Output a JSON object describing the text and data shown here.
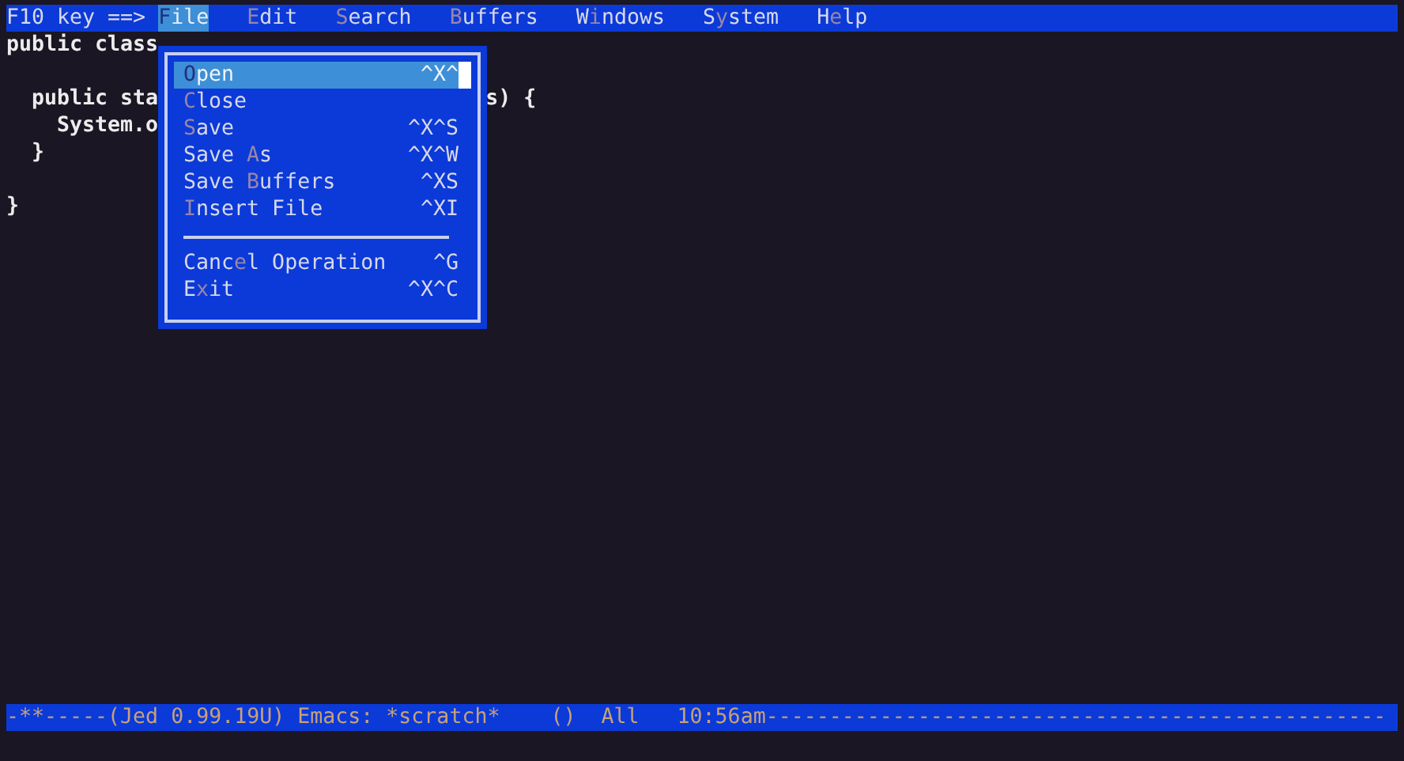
{
  "menubar": {
    "prompt": "F10 key ==>",
    "items": [
      {
        "key": "F",
        "after": "ile",
        "selected": true
      },
      {
        "key": "E",
        "after": "dit",
        "selected": false
      },
      {
        "key": "S",
        "after": "earch",
        "selected": false
      },
      {
        "key": "B",
        "after": "uffers",
        "selected": false
      },
      {
        "before": "W",
        "key": "i",
        "after": "ndows",
        "selected": false
      },
      {
        "before": "S",
        "key": "y",
        "after": "stem",
        "selected": false
      },
      {
        "before": "H",
        "key": "e",
        "after": "lp",
        "selected": false
      }
    ]
  },
  "code_lines": [
    {
      "kind": "text",
      "left": "public class"
    },
    {
      "kind": "blank"
    },
    {
      "kind": "text",
      "left": "  public sta",
      "right": "s) {"
    },
    {
      "kind": "text",
      "left": "    System.o"
    },
    {
      "kind": "text",
      "left": "  }"
    },
    {
      "kind": "blank"
    },
    {
      "kind": "text",
      "left": "}"
    }
  ],
  "menu": {
    "items": [
      {
        "kind": "item",
        "key": "O",
        "after": "pen",
        "shortcut": "^X^",
        "selected": true
      },
      {
        "kind": "item",
        "key": "C",
        "after": "lose",
        "selected": false
      },
      {
        "kind": "item",
        "key": "S",
        "after": "ave",
        "shortcut": "^X^S",
        "selected": false
      },
      {
        "kind": "item",
        "before": "Save ",
        "key": "A",
        "after": "s",
        "shortcut": "^X^W",
        "selected": false
      },
      {
        "kind": "item",
        "before": "Save ",
        "key": "B",
        "after": "uffers",
        "shortcut": "^XS",
        "selected": false
      },
      {
        "kind": "item",
        "key": "I",
        "after": "nsert File",
        "shortcut": "^XI",
        "selected": false
      },
      {
        "kind": "separator"
      },
      {
        "kind": "item",
        "before": "Canc",
        "key": "e",
        "after": "l Operation",
        "shortcut": "^G",
        "selected": false
      },
      {
        "kind": "item",
        "before": "E",
        "key": "x",
        "after": "it",
        "shortcut": "^X^C",
        "selected": false
      }
    ]
  },
  "status_line": "-**-----(Jed 0.99.19U) Emacs: *scratch*    ()  All   10:56am-------------------------------------------------"
}
